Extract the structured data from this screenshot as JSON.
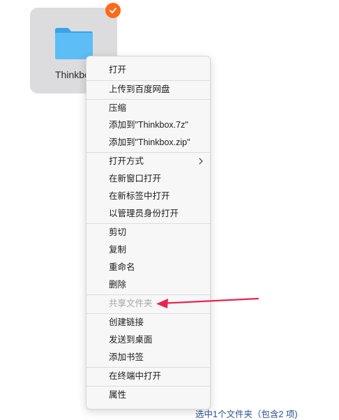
{
  "desktop": {
    "folder": {
      "name_visible": "Thinkbox",
      "selected": true,
      "icon": "folder-icon",
      "badge_icon": "checkmark-icon",
      "badge_color": "#ff6a1a",
      "folder_color": "#5cbef5"
    }
  },
  "context_menu": {
    "groups": [
      [
        {
          "label": "打开",
          "enabled": true
        }
      ],
      [
        {
          "label": "上传到百度网盘",
          "enabled": true
        }
      ],
      [
        {
          "label": "压缩",
          "enabled": true
        },
        {
          "label": "添加到\"Thinkbox.7z\"",
          "enabled": true
        },
        {
          "label": "添加到\"Thinkbox.zip\"",
          "enabled": true
        }
      ],
      [
        {
          "label": "打开方式",
          "enabled": true,
          "submenu": true,
          "icon": "chevron-right-icon"
        },
        {
          "label": "在新窗口打开",
          "enabled": true
        },
        {
          "label": "在新标签中打开",
          "enabled": true
        },
        {
          "label": "以管理员身份打开",
          "enabled": true
        }
      ],
      [
        {
          "label": "剪切",
          "enabled": true
        },
        {
          "label": "复制",
          "enabled": true
        },
        {
          "label": "重命名",
          "enabled": true
        },
        {
          "label": "删除",
          "enabled": true
        }
      ],
      [
        {
          "label": "共享文件夹",
          "enabled": false
        }
      ],
      [
        {
          "label": "创建链接",
          "enabled": true
        },
        {
          "label": "发送到桌面",
          "enabled": true
        },
        {
          "label": "添加书签",
          "enabled": true
        }
      ],
      [
        {
          "label": "在终端中打开",
          "enabled": true
        }
      ],
      [
        {
          "label": "属性",
          "enabled": true
        }
      ]
    ]
  },
  "status_bar": {
    "text": "选中1个文件夹（包含2 项)"
  },
  "annotation": {
    "icon": "arrow-left-icon",
    "color": "#e8244f",
    "points_to": "共享文件夹"
  }
}
